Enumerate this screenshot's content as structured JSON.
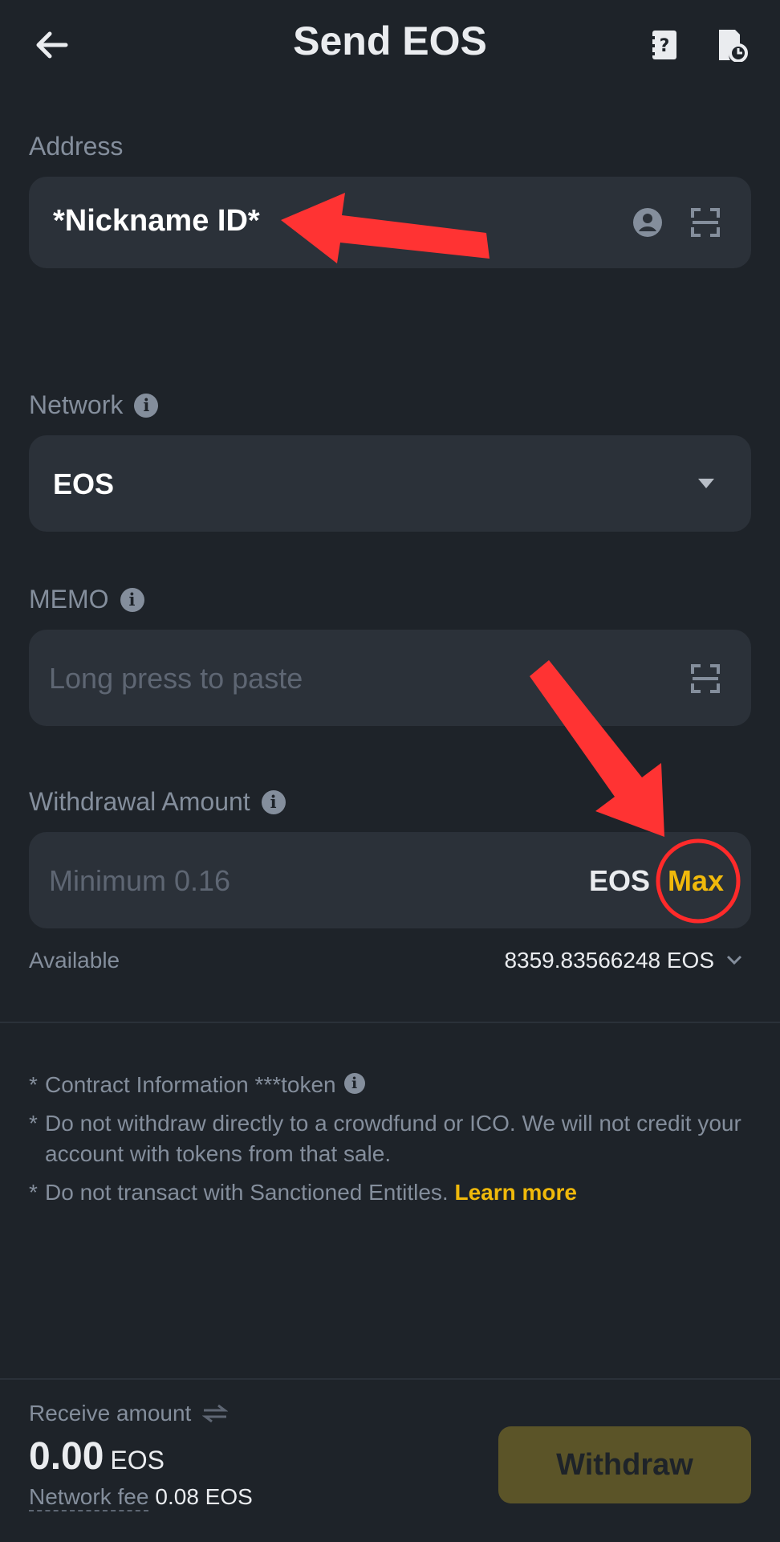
{
  "header": {
    "title": "Send EOS"
  },
  "address": {
    "label": "Address",
    "value": "*Nickname ID*"
  },
  "network": {
    "label": "Network",
    "value": "EOS"
  },
  "memo": {
    "label": "MEMO",
    "placeholder": "Long press to paste"
  },
  "amount": {
    "label": "Withdrawal Amount",
    "placeholder": "Minimum 0.16",
    "unit": "EOS",
    "max_label": "Max"
  },
  "available": {
    "label": "Available",
    "value": "8359.83566248 EOS"
  },
  "notes": {
    "star": "*",
    "contract": "Contract Information ***token",
    "crowdfund": "Do not withdraw directly to a crowdfund or ICO. We will not credit your account with tokens from that sale.",
    "sanctioned": "Do not transact with Sanctioned Entitles.",
    "learn_more": "Learn more"
  },
  "footer": {
    "receive_label": "Receive amount",
    "receive_value": "0.00",
    "receive_unit": "EOS",
    "fee_label": "Network fee",
    "fee_value": "0.08 EOS",
    "withdraw_label": "Withdraw"
  },
  "colors": {
    "background": "#1e2329",
    "field": "#2b3139",
    "accent": "#f0b90b",
    "annotation_red": "#ff3333",
    "muted": "#848e9c"
  }
}
